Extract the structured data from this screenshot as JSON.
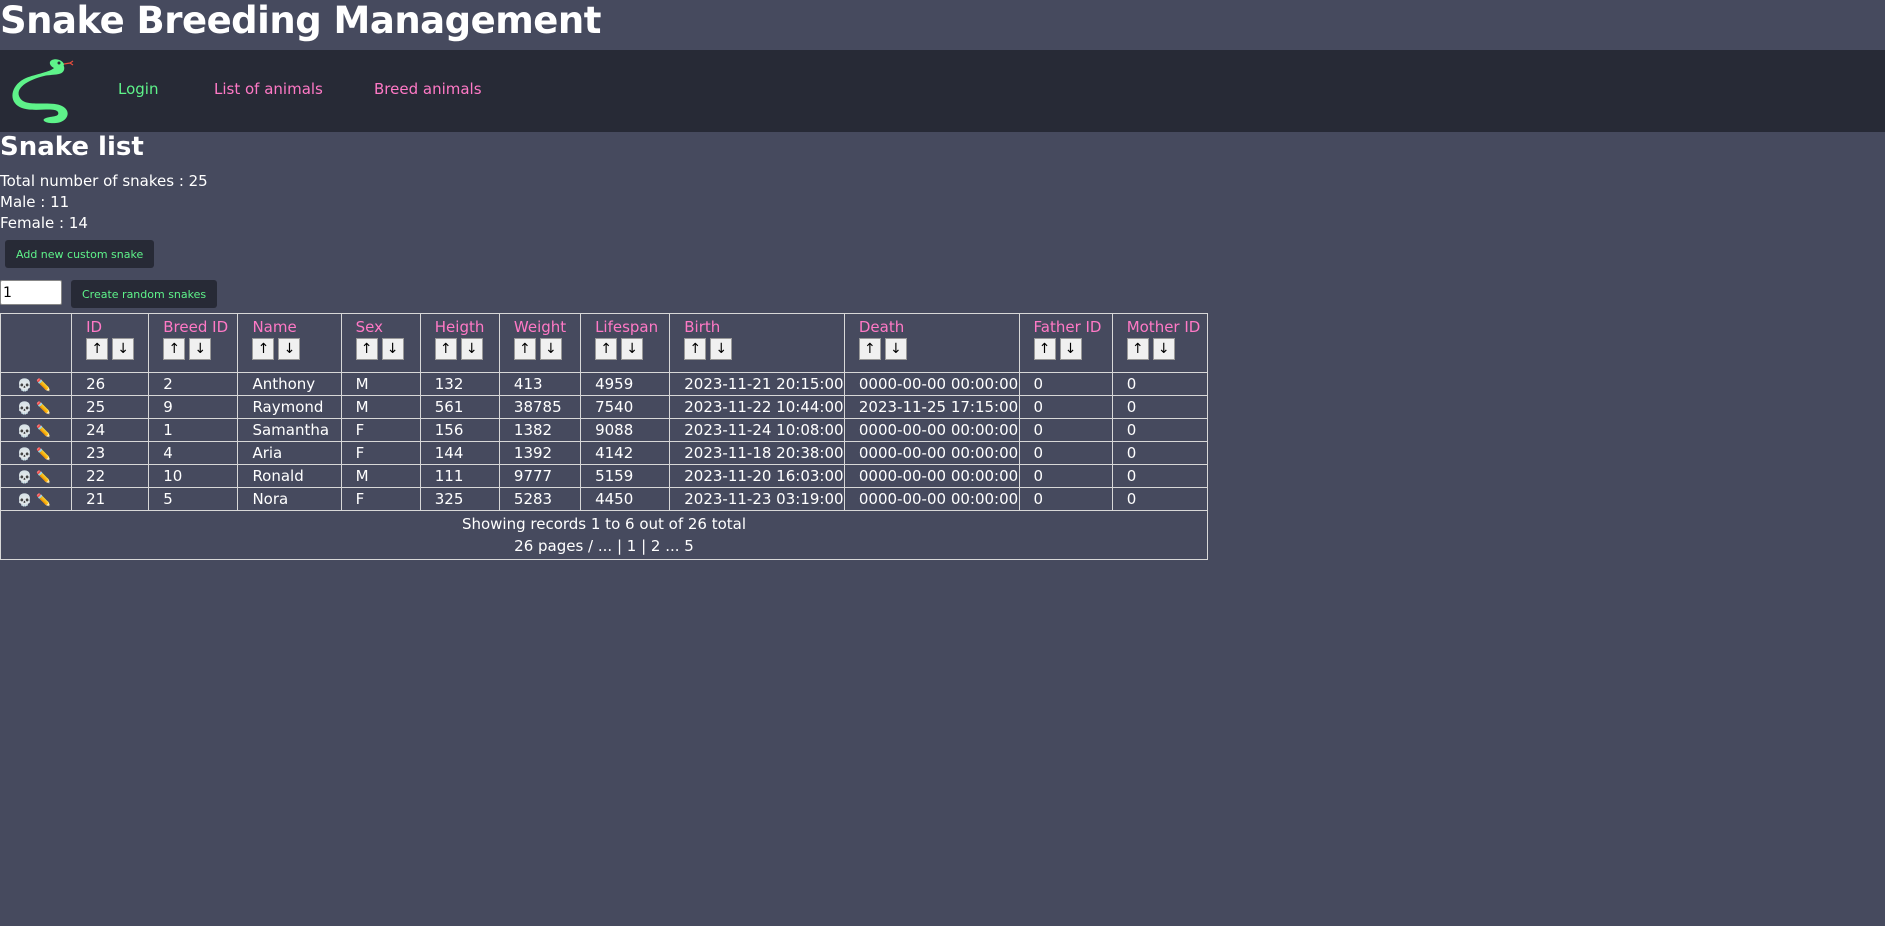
{
  "app": {
    "title": "Snake Breeding Management"
  },
  "nav": {
    "login": "Login",
    "list": "List of animals",
    "breed": "Breed animals"
  },
  "page": {
    "heading": "Snake list",
    "total": "Total number of snakes : 25",
    "male": "Male : 11",
    "female": "Female : 14",
    "add_button": "Add new custom snake",
    "random_count": "1",
    "random_button": "Create random snakes"
  },
  "table": {
    "columns": [
      "ID",
      "Breed ID",
      "Name",
      "Sex",
      "Heigth",
      "Weight",
      "Lifespan",
      "Birth",
      "Death",
      "Father ID",
      "Mother ID"
    ],
    "rows": [
      [
        "26",
        "2",
        "Anthony",
        "M",
        "132",
        "413",
        "4959",
        "2023-11-21 20:15:00",
        "0000-00-00 00:00:00",
        "0",
        "0"
      ],
      [
        "25",
        "9",
        "Raymond",
        "M",
        "561",
        "38785",
        "7540",
        "2023-11-22 10:44:00",
        "2023-11-25 17:15:00",
        "0",
        "0"
      ],
      [
        "24",
        "1",
        "Samantha",
        "F",
        "156",
        "1382",
        "9088",
        "2023-11-24 10:08:00",
        "0000-00-00 00:00:00",
        "0",
        "0"
      ],
      [
        "23",
        "4",
        "Aria",
        "F",
        "144",
        "1392",
        "4142",
        "2023-11-18 20:38:00",
        "0000-00-00 00:00:00",
        "0",
        "0"
      ],
      [
        "22",
        "10",
        "Ronald",
        "M",
        "111",
        "9777",
        "5159",
        "2023-11-20 16:03:00",
        "0000-00-00 00:00:00",
        "0",
        "0"
      ],
      [
        "21",
        "5",
        "Nora",
        "F",
        "325",
        "5283",
        "4450",
        "2023-11-23 03:19:00",
        "0000-00-00 00:00:00",
        "0",
        "0"
      ]
    ],
    "sort_up": "↑",
    "sort_down": "↓",
    "delete_icon": "💀",
    "edit_icon": "✏️",
    "footer_records": "Showing records 1 to 6 out of 26 total",
    "footer_pages": "26 pages / ... | 1 | 2 ... 5"
  },
  "colors": {
    "background": "#464a5e",
    "navbar": "#272a36",
    "green": "#5ef38a",
    "pink": "#ff79c6"
  },
  "icons": {
    "logo": "snake-logo-icon"
  }
}
